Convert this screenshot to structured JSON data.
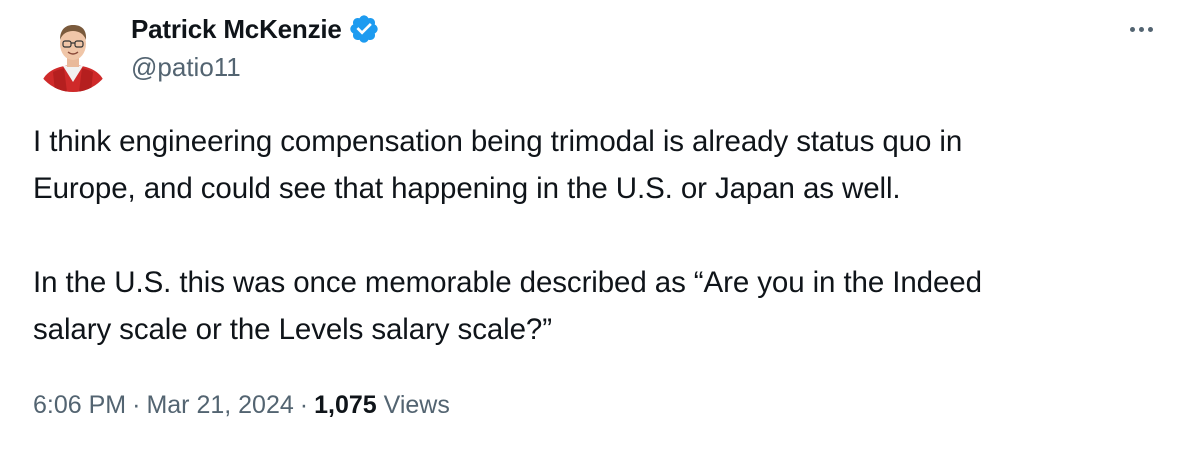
{
  "author": {
    "display_name": "Patrick McKenzie",
    "handle": "@patio11",
    "verified_icon": "verified-badge-icon",
    "verified_color": "#1d9bf0"
  },
  "more_icon": "more-options-icon",
  "tweet": {
    "paragraphs": [
      [
        "I think engineering compensation being trimodal is already status quo in",
        "Europe, and could see that happening in the U.S. or Japan as well."
      ],
      [
        "In the U.S. this was once memorable described as “Are you in the Indeed",
        "salary scale or the Levels salary scale?”"
      ]
    ]
  },
  "meta": {
    "time": "6:06 PM",
    "date": "Mar 21, 2024",
    "separator": "·",
    "views_count": "1,075",
    "views_label": "Views"
  },
  "colors": {
    "text": "#0f1419",
    "secondary": "#536471",
    "accent": "#1d9bf0"
  }
}
